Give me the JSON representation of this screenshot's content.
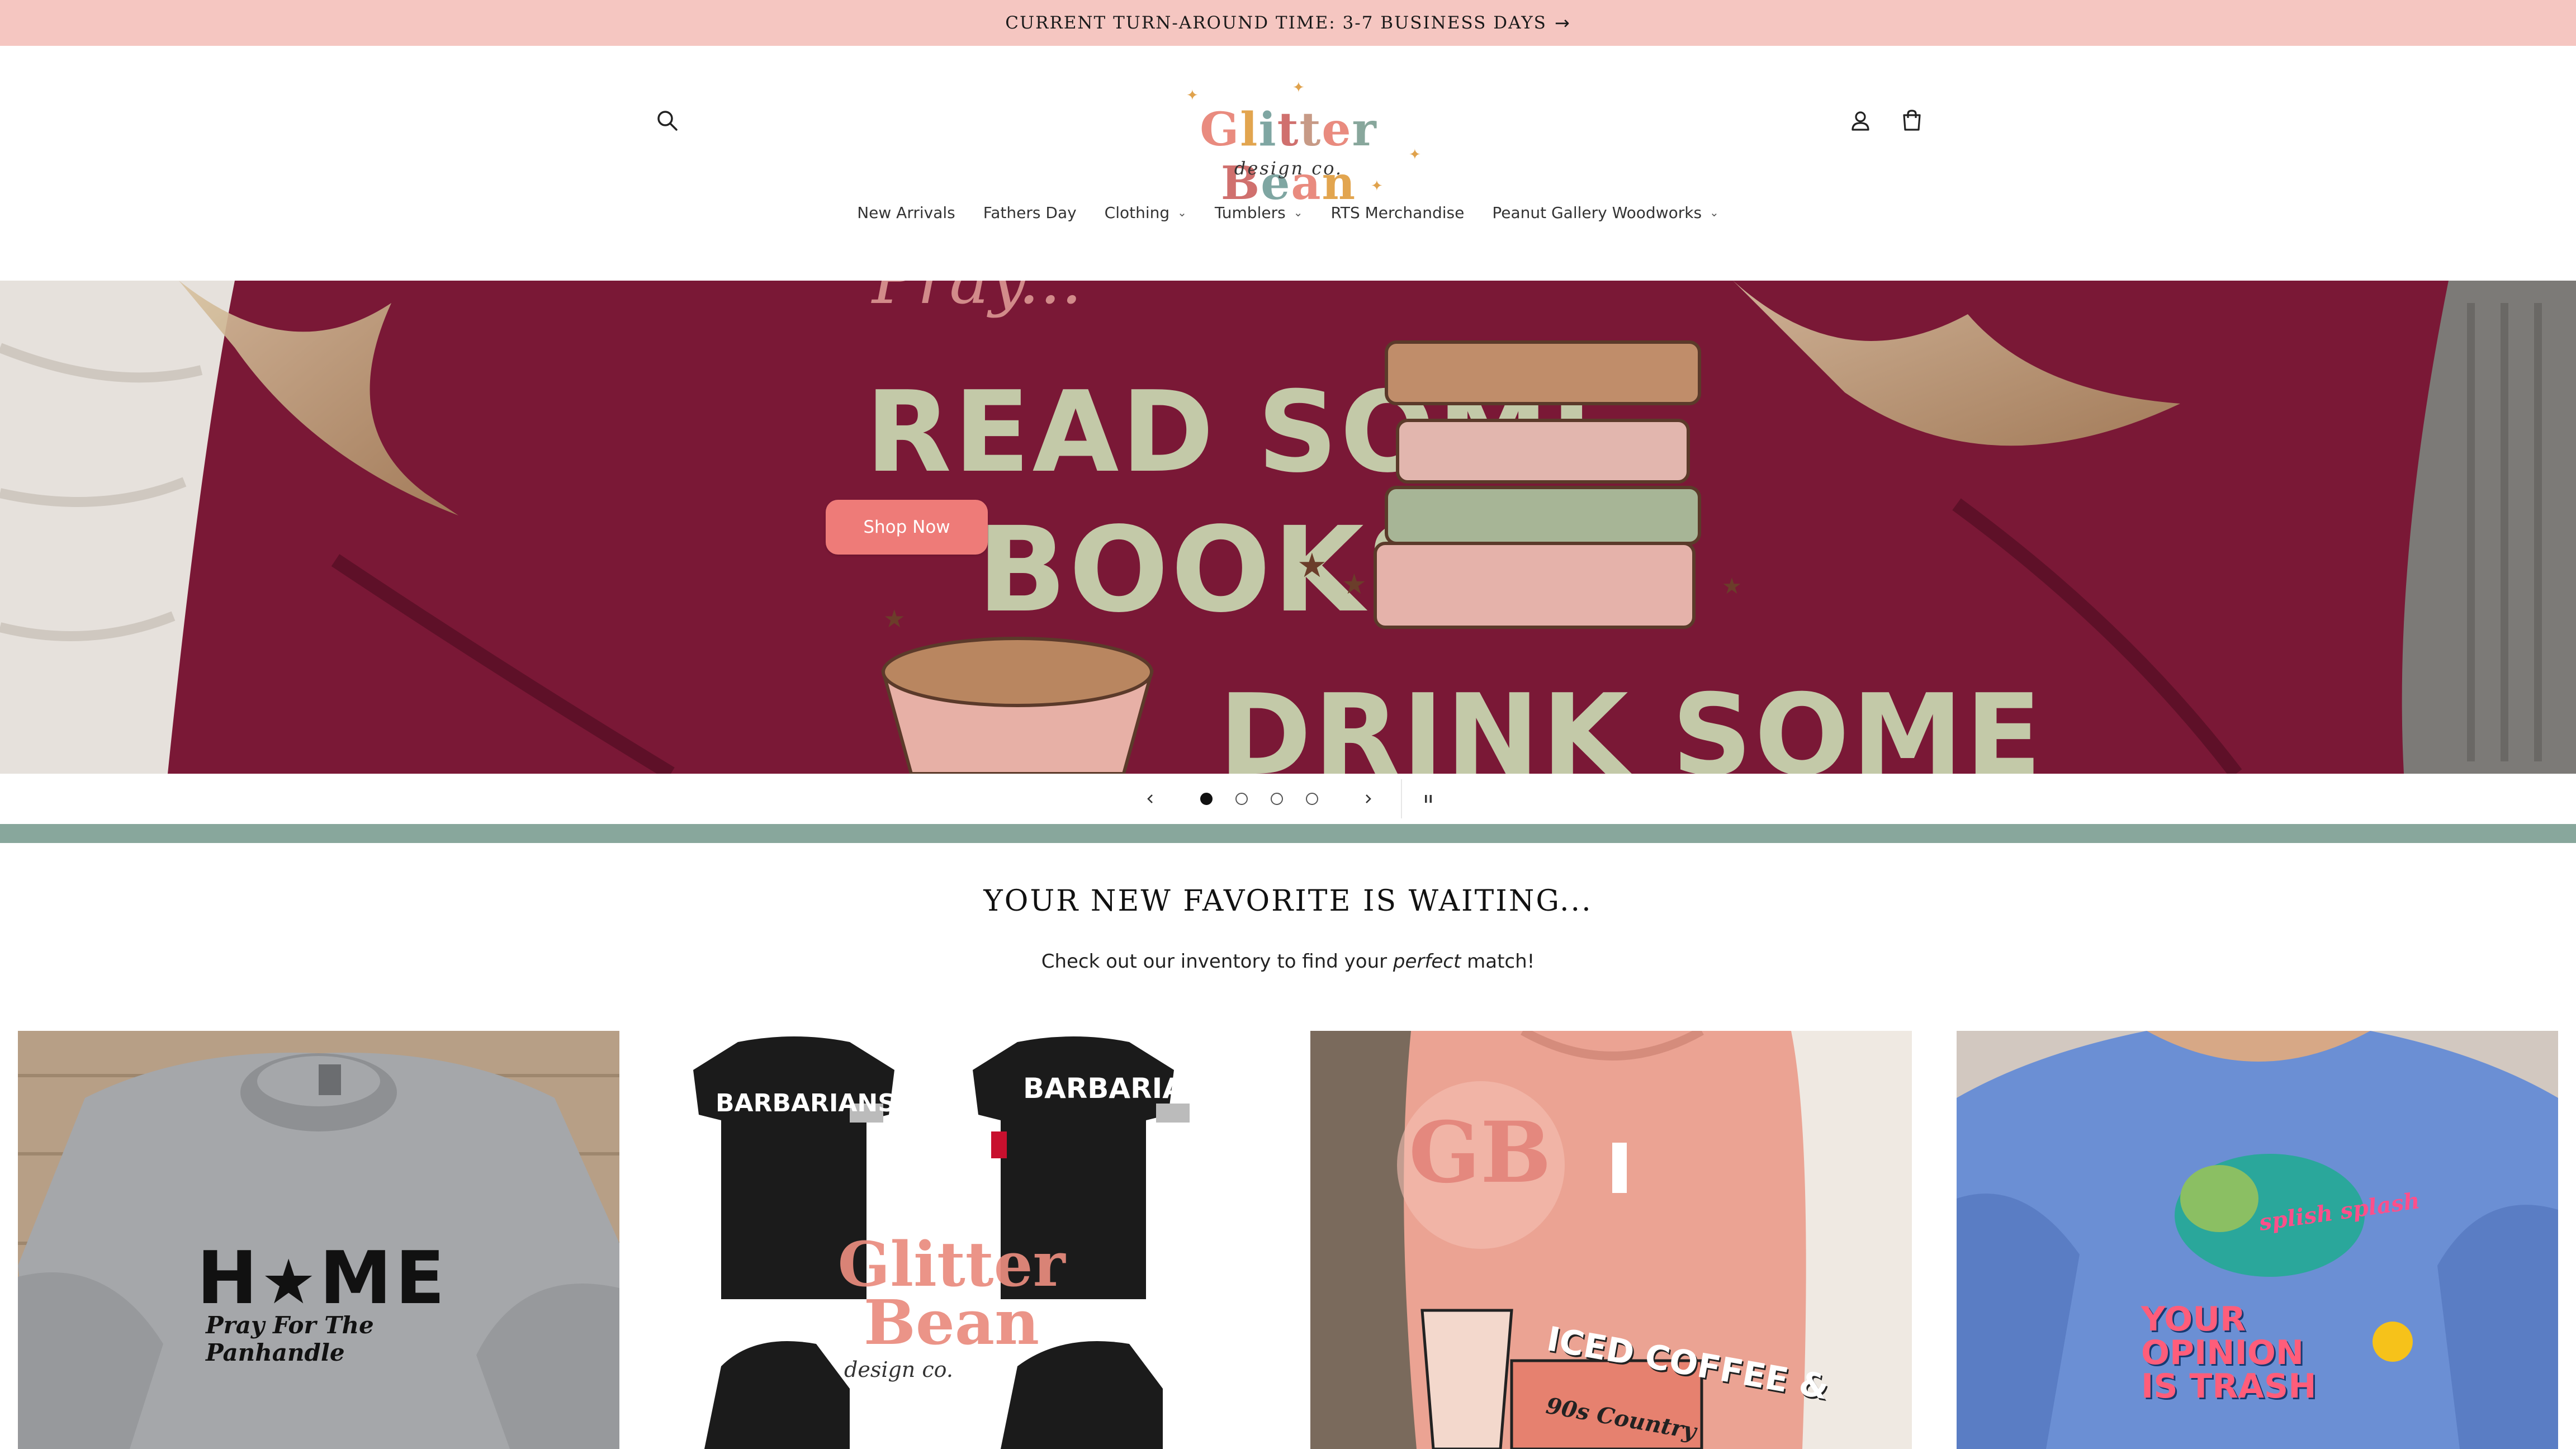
{
  "announcement": {
    "text": "CURRENT TURN-AROUND TIME: 3-7 BUSINESS DAYS",
    "arrow": "→"
  },
  "header": {
    "logo": {
      "text": "Glitter Bean",
      "tagline": "design co."
    },
    "icons": {
      "search": "search-icon",
      "account": "account-icon",
      "cart": "cart-icon"
    }
  },
  "nav": {
    "items": [
      {
        "label": "New Arrivals",
        "dropdown": false
      },
      {
        "label": "Fathers Day",
        "dropdown": false
      },
      {
        "label": "Clothing",
        "dropdown": true
      },
      {
        "label": "Tumblers",
        "dropdown": true
      },
      {
        "label": "RTS Merchandise",
        "dropdown": false
      },
      {
        "label": "Peanut Gallery Woodworks",
        "dropdown": true
      }
    ]
  },
  "hero": {
    "line1": "READ SOME",
    "line2": "BOOKS",
    "line3": "DRINK SOME",
    "button": "Shop Now",
    "slides_total": 4,
    "active_slide": 1
  },
  "collection": {
    "title": "YOUR NEW FAVORITE IS WAITING...",
    "subtitle_before": "Check out our inventory to find your ",
    "subtitle_em": "perfect",
    "subtitle_after": " match!"
  },
  "products": [
    {
      "print_main": "H",
      "print_end": "ME",
      "print_sub": "Pray For The Panhandle"
    },
    {
      "print_main": "BARBARIANS",
      "watermark": "Glitter Bean",
      "watermark_sub": "design co."
    },
    {
      "badge": "GB",
      "print_main": "ICED COFFEE &",
      "print_sub": "90s Country"
    },
    {
      "print_top": "splish splash",
      "print_main": "YOUR",
      "print_mid": "OPINION",
      "print_end": "IS TRASH"
    }
  ],
  "colors": {
    "announcement_bg": "#f5c6c1",
    "button_bg": "#ee7b78",
    "teal_band": "#88a79c",
    "hero_sweater": "#7a1836"
  }
}
